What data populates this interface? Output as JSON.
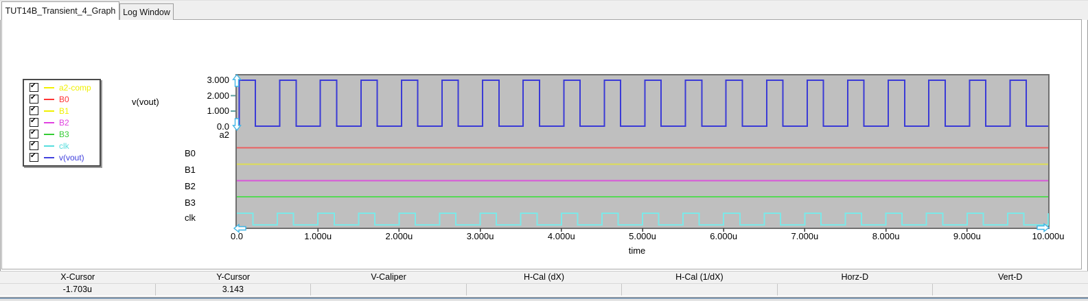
{
  "tabs": [
    {
      "label": "TUT14B_Transient_4_Graph",
      "active": true
    },
    {
      "label": "Log Window",
      "active": false
    }
  ],
  "legend": {
    "items": [
      {
        "label": "a2-comp",
        "color": "#f0f000",
        "checked": true
      },
      {
        "label": "B0",
        "color": "#ff3333",
        "checked": true
      },
      {
        "label": "B1",
        "color": "#f0f000",
        "checked": true
      },
      {
        "label": "B2",
        "color": "#e040e0",
        "checked": true
      },
      {
        "label": "B3",
        "color": "#33cc33",
        "checked": true
      },
      {
        "label": "clk",
        "color": "#55dddd",
        "checked": true
      },
      {
        "label": "v(vout)",
        "color": "#4040dd",
        "checked": true
      }
    ]
  },
  "chart_data": {
    "type": "line",
    "title": "",
    "grid": false,
    "plot_background": "#bfbfbf",
    "x": {
      "label": "time",
      "min_us": 0,
      "max_us": 10,
      "tick_labels": [
        "0.0",
        "1.000u",
        "2.000u",
        "3.000u",
        "4.000u",
        "5.000u",
        "6.000u",
        "7.000u",
        "8.000u",
        "9.000u",
        "10.000u"
      ],
      "tick_values_us": [
        0,
        1,
        2,
        3,
        4,
        5,
        6,
        7,
        8,
        9,
        10
      ]
    },
    "y_analog": {
      "label": "v(vout)",
      "tick_labels": [
        "3.000",
        "2.000",
        "1.000",
        "0.0"
      ],
      "tick_values": [
        3,
        2,
        1,
        0
      ],
      "minor_tick_values": [
        2,
        1
      ]
    },
    "digital_lanes": [
      "a2",
      "B0",
      "B1",
      "B2",
      "B3",
      "clk"
    ],
    "series": [
      {
        "name": "v(vout)",
        "kind": "pulse",
        "color": "#3a3ad6",
        "period_us": 0.5,
        "rise_us": 0.03,
        "fall_us": 0.23,
        "initial": "low",
        "high_v": 3.0,
        "low_v": 0.0
      },
      {
        "name": "B0",
        "kind": "constant",
        "color": "#ea6060"
      },
      {
        "name": "B1",
        "kind": "constant",
        "color": "#dede55"
      },
      {
        "name": "B2",
        "kind": "constant",
        "color": "#d855d8"
      },
      {
        "name": "B3",
        "kind": "constant",
        "color": "#55d855"
      },
      {
        "name": "clk",
        "kind": "pulse",
        "color": "#7ce8e8",
        "period_us": 0.5,
        "rise_us": 0.0,
        "fall_us": 0.2,
        "initial": "high"
      }
    ]
  },
  "cursors": {
    "x_readout": "-1.703u",
    "y_readout": "3.143",
    "markers": [
      {
        "id": "y-top",
        "dir": "up"
      },
      {
        "id": "y-bottom",
        "dir": "down"
      },
      {
        "id": "x-left",
        "dir": "left"
      },
      {
        "id": "x-right",
        "dir": "right"
      }
    ],
    "marker_color": "#3fb6e6"
  },
  "status_bar": {
    "columns": [
      {
        "header": "X-Cursor",
        "value": "-1.703u"
      },
      {
        "header": "Y-Cursor",
        "value": "3.143"
      },
      {
        "header": "V-Caliper",
        "value": ""
      },
      {
        "header": "H-Cal (dX)",
        "value": ""
      },
      {
        "header": "H-Cal (1/dX)",
        "value": ""
      },
      {
        "header": "Horz-D",
        "value": ""
      },
      {
        "header": "Vert-D",
        "value": ""
      }
    ]
  }
}
